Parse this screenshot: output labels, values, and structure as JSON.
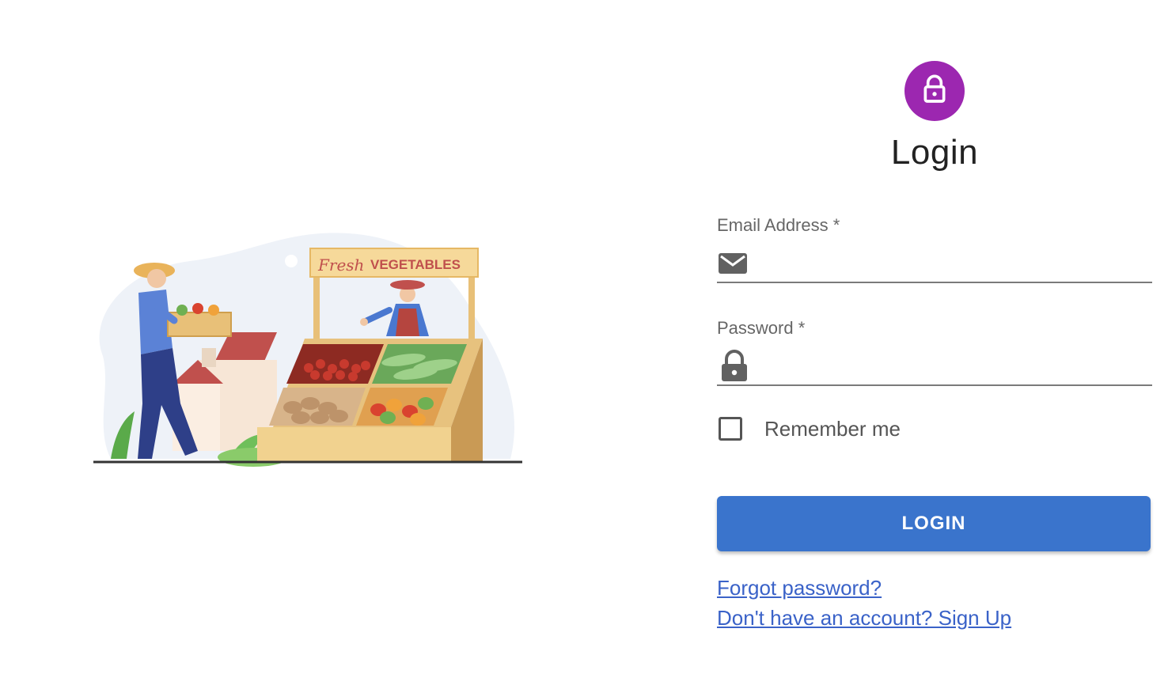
{
  "illustration": {
    "sign_script": "Fresh",
    "sign_text": "VEGETABLES"
  },
  "login": {
    "avatar_icon": "lock-icon",
    "title": "Login",
    "email": {
      "label": "Email Address *",
      "icon": "envelope-icon",
      "value": ""
    },
    "password": {
      "label": "Password *",
      "icon": "lock-icon",
      "value": ""
    },
    "remember_label": "Remember me",
    "remember_checked": false,
    "submit_label": "LOGIN",
    "forgot_link": "Forgot password?",
    "signup_link": "Don't have an account? Sign Up"
  },
  "colors": {
    "avatar_bg": "#9c27b0",
    "button_bg": "#3a74cc",
    "link": "#3a62c8"
  }
}
